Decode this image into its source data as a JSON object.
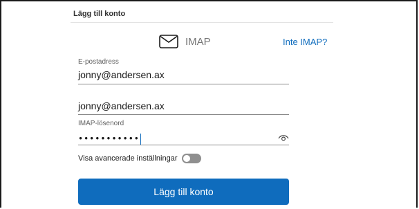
{
  "header": {
    "title": "Lägg till konto"
  },
  "protocol": {
    "label": "IMAP",
    "icon": "mail-icon",
    "switch_link": "Inte IMAP?"
  },
  "email_field": {
    "label": "E-postadress",
    "value": "jonny@andersen.ax"
  },
  "username_field": {
    "value": "jonny@andersen.ax"
  },
  "password_field": {
    "label": "IMAP-lösenord",
    "masked_value": "•••••••••••",
    "reveal_icon": "eye-icon"
  },
  "advanced": {
    "label": "Visa avancerade inställningar",
    "enabled": false
  },
  "submit": {
    "label": "Lägg till konto"
  },
  "colors": {
    "accent": "#0f6cbd",
    "toggle_off": "#8f8f8f"
  }
}
